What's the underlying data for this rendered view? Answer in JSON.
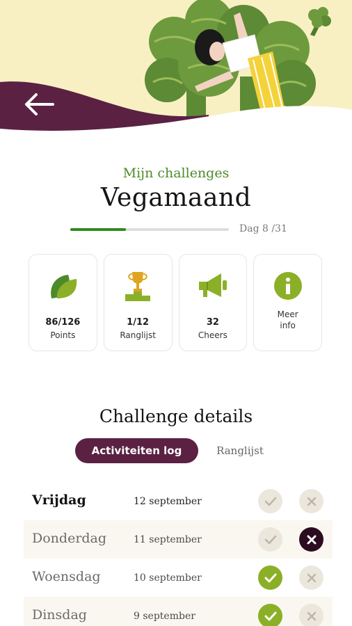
{
  "header": {
    "back_icon": "arrow-left-icon",
    "colors": {
      "top_band": "#f8f0c3",
      "wave": "#5b2143",
      "broccoli": "#6e9a3e"
    }
  },
  "challenge": {
    "subtitle": "Mijn challenges",
    "title": "Vegamaand",
    "progress": 0.35,
    "day_label": "Dag 8 /31",
    "progress_color": "#2f8a1f"
  },
  "stats": [
    {
      "icon": "leaf-icon",
      "value": "86/126",
      "label": "Points"
    },
    {
      "icon": "trophy-icon",
      "value": "1/12",
      "label": "Ranglijst"
    },
    {
      "icon": "megaphone-icon",
      "value": "32",
      "label": "Cheers"
    },
    {
      "icon": "info-icon",
      "value": "",
      "label": "Meer\ninfo"
    }
  ],
  "details": {
    "title": "Challenge details",
    "tabs": [
      {
        "label": "Activiteiten log",
        "active": true
      },
      {
        "label": "Ranglijst",
        "active": false
      }
    ]
  },
  "log": [
    {
      "day": "Vrijdag",
      "date": "12 september",
      "check": "pending",
      "cross": "pending"
    },
    {
      "day": "Donderdag",
      "date": "11 september",
      "check": "pending",
      "cross": "selected"
    },
    {
      "day": "Woensdag",
      "date": "10 september",
      "check": "selected",
      "cross": "pending"
    },
    {
      "day": "Dinsdag",
      "date": "9 september",
      "check": "selected",
      "cross": "pending"
    }
  ]
}
